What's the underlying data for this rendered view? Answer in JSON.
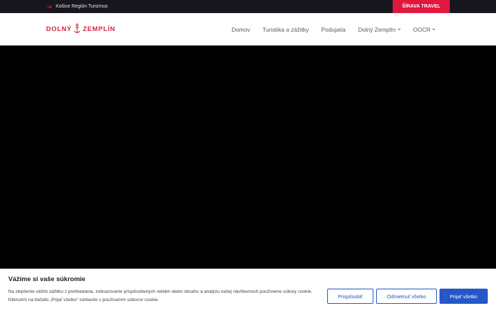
{
  "topbar": {
    "region_link": "Košice Región Turizmus",
    "cta": "ŠÍRAVA TRAVEL"
  },
  "header": {
    "logo_left": "DOLNÝ",
    "logo_right": "ZEMPLÍN",
    "nav": [
      {
        "label": "Domov",
        "has_dropdown": false
      },
      {
        "label": "Turistika a zážitky",
        "has_dropdown": false
      },
      {
        "label": "Podujatia",
        "has_dropdown": false
      },
      {
        "label": "Dolný Zemplín",
        "has_dropdown": true
      },
      {
        "label": "OOCR",
        "has_dropdown": true
      }
    ]
  },
  "cookie": {
    "title": "Vážime si vaše súkromie",
    "text": "Na zlepšenie vášho zážitku z prehliadania, zobrazovanie prispôsobených reklám alebo obsahu a analýzu našej návštevnosti používame súbory cookie. Kliknutím na tlačidlo „Prijať všetko“ súhlasíte s používaním súborov cookie.",
    "btn_customize": "Prispôsobiť",
    "btn_reject": "Odmietnuť všetko",
    "btn_accept": "Prijať všetko"
  },
  "colors": {
    "brand_red": "#d6213c",
    "cta_red": "#e0173e",
    "accent_blue": "#2255c4",
    "topbar_bg": "#16161e"
  }
}
